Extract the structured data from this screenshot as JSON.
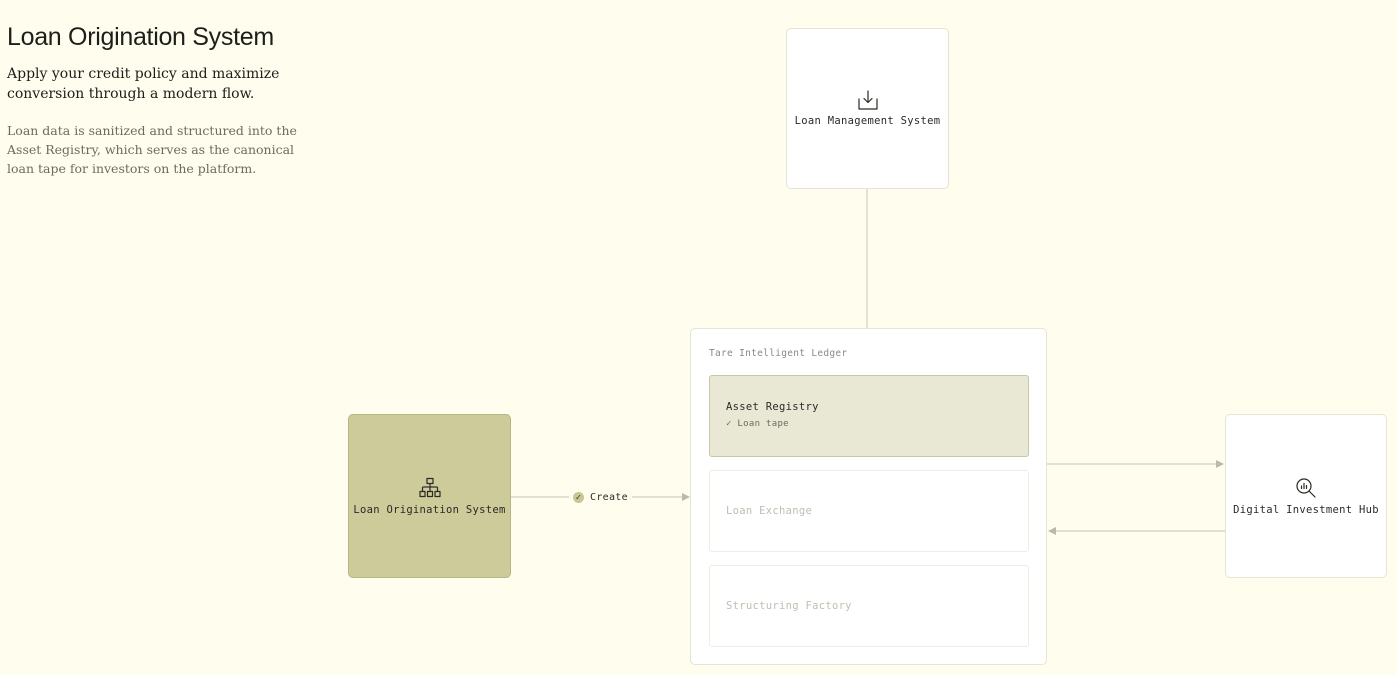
{
  "intro": {
    "title": "Loan Origination System",
    "lead": "Apply your credit policy and maximize conversion through a modern flow.",
    "description": "Loan data is sanitized and structured into the Asset Registry, which serves as the canonical loan tape for investors on the platform."
  },
  "nodes": {
    "loan_management": {
      "label": "Loan Management System",
      "icon": "download-icon"
    },
    "loan_origination": {
      "label": "Loan Origination System",
      "icon": "hierarchy-icon"
    },
    "digital_investment": {
      "label": "Digital Investment Hub",
      "icon": "search-chart-icon"
    }
  },
  "edges": {
    "create": {
      "label": "Create",
      "icon": "check-icon",
      "check_glyph": "✓"
    }
  },
  "ledger": {
    "title": "Tare Intelligent Ledger",
    "modules": [
      {
        "label": "Asset Registry",
        "sub": "✓ Loan tape",
        "active": true
      },
      {
        "label": "Loan Exchange",
        "active": false
      },
      {
        "label": "Structuring Factory",
        "active": false
      }
    ]
  },
  "colors": {
    "background": "#fffdee",
    "accent_node": "#cccb99",
    "active_module": "#e9e8d5",
    "connector": "#d2d0bd"
  }
}
